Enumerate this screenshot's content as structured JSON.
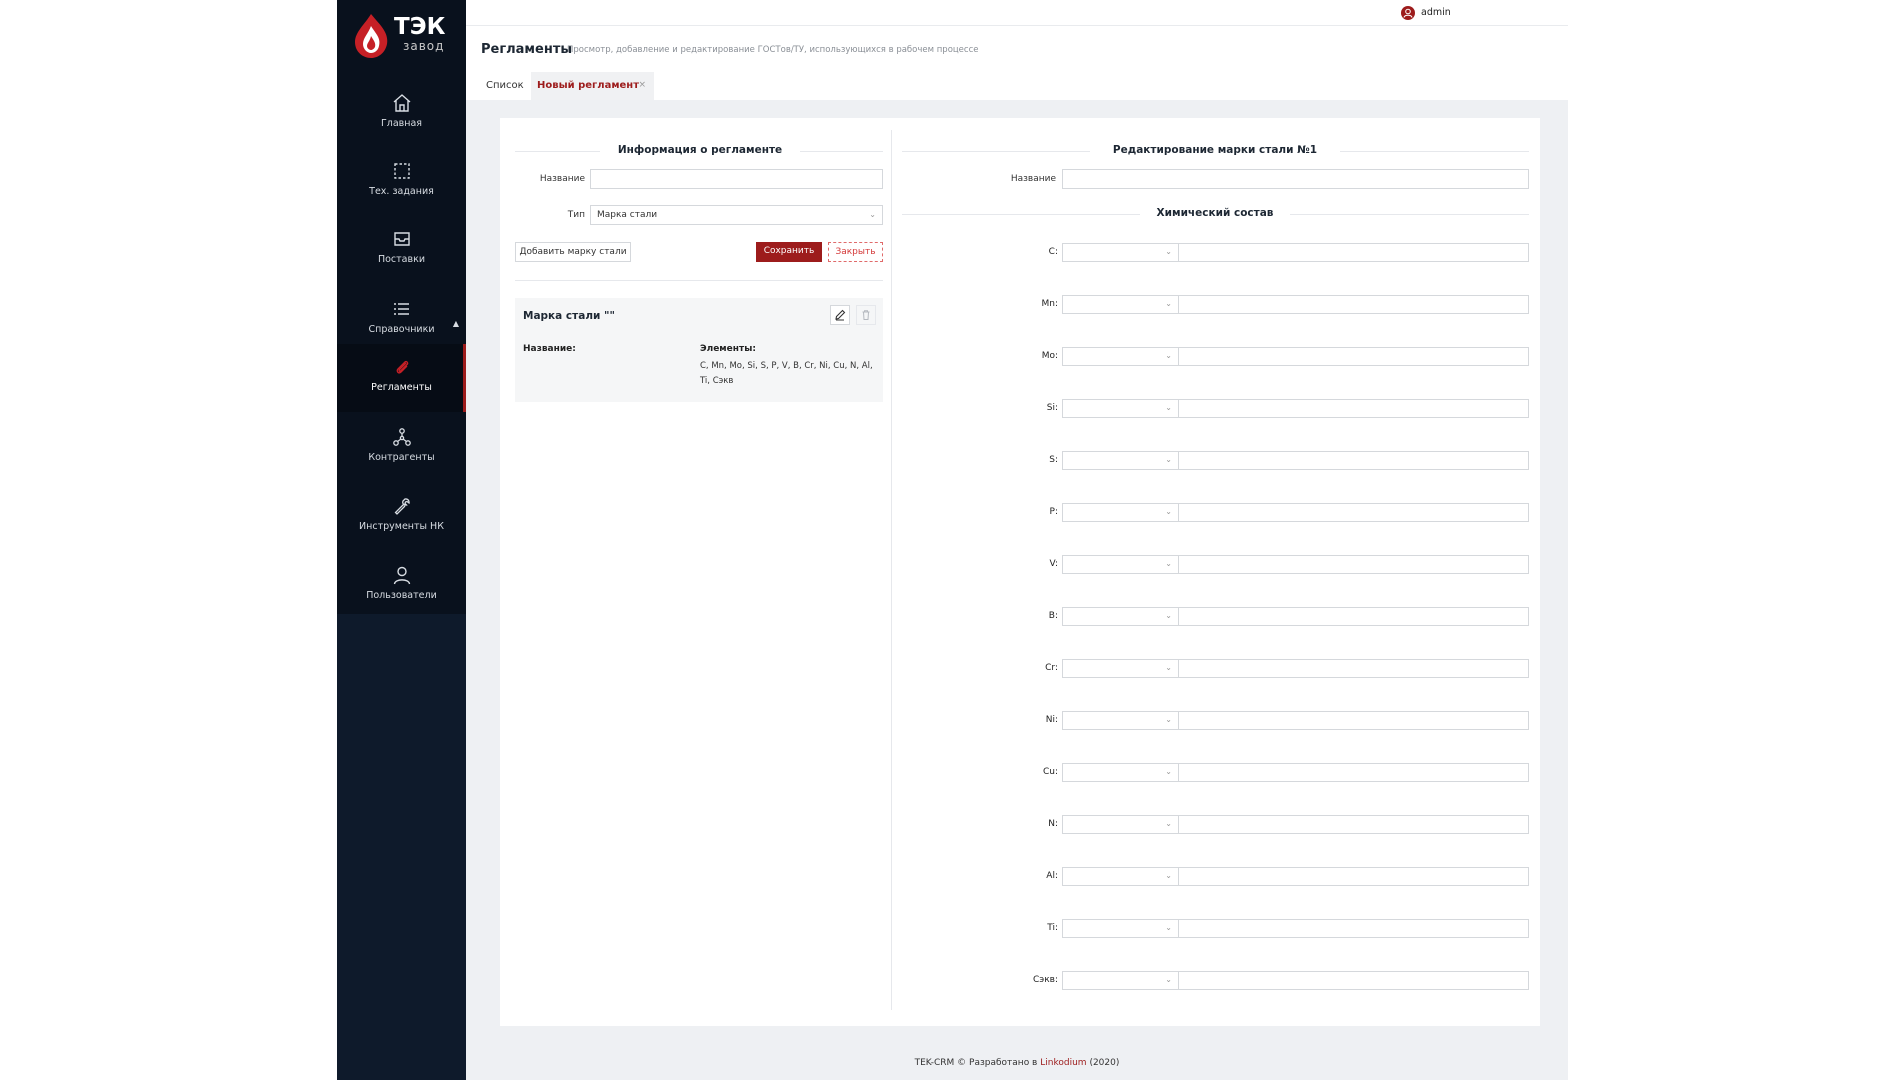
{
  "brand": {
    "name": "ТЭК",
    "sub": "завод"
  },
  "sidebar": {
    "items": [
      {
        "label": "Главная",
        "icon": "home-icon"
      },
      {
        "label": "Тех. задания",
        "icon": "selection-icon"
      },
      {
        "label": "Поставки",
        "icon": "inbox-icon"
      },
      {
        "label": "Справочники",
        "icon": "list-icon"
      },
      {
        "label": "Регламенты",
        "icon": "paperclip-icon",
        "active": true
      },
      {
        "label": "Контрагенты",
        "icon": "network-icon"
      },
      {
        "label": "Инструменты НК",
        "icon": "wrench-icon"
      },
      {
        "label": "Пользователи",
        "icon": "user-icon"
      }
    ]
  },
  "topbar": {
    "user": "admin"
  },
  "page": {
    "title": "Регламенты",
    "subtitle": "Просмотр, добавление и редактирование ГОСТов/ТУ, использующихся в рабочем процессе"
  },
  "tabs": [
    {
      "label": "Список"
    },
    {
      "label": "Новый регламент",
      "active": true,
      "close": "×"
    }
  ],
  "left_panel": {
    "title": "Информация о регламенте",
    "name_label": "Название",
    "name_value": "",
    "type_label": "Тип",
    "type_value": "Марка стали",
    "add_button": "Добавить марку стали",
    "save_button": "Сохранить",
    "close_button": "Закрыть",
    "steel_card": {
      "title": "Марка стали \"\"",
      "name_key": "Название:",
      "elements_key": "Элементы:",
      "elements_value": "C, Mn, Mo, Si, S, P, V, B, Cr, Ni, Cu, N, Al, Ti, Сэкв"
    }
  },
  "right_panel": {
    "title": "Редактирование марки стали №1",
    "name_label": "Название",
    "name_value": "",
    "chem_title": "Химический состав",
    "elements": [
      "C:",
      "Mn:",
      "Mo:",
      "Si:",
      "S:",
      "P:",
      "V:",
      "B:",
      "Cr:",
      "Ni:",
      "Cu:",
      "N:",
      "Al:",
      "Ti:",
      "Сэкв:"
    ]
  },
  "footer": {
    "prefix": "TEK-CRM © Разработано в",
    "link": "Linkodium",
    "suffix": "(2020)"
  },
  "colors": {
    "sidebar_bg": "#0e1a2b",
    "accent": "#9d1c1c",
    "content_bg": "#eef0f3"
  }
}
